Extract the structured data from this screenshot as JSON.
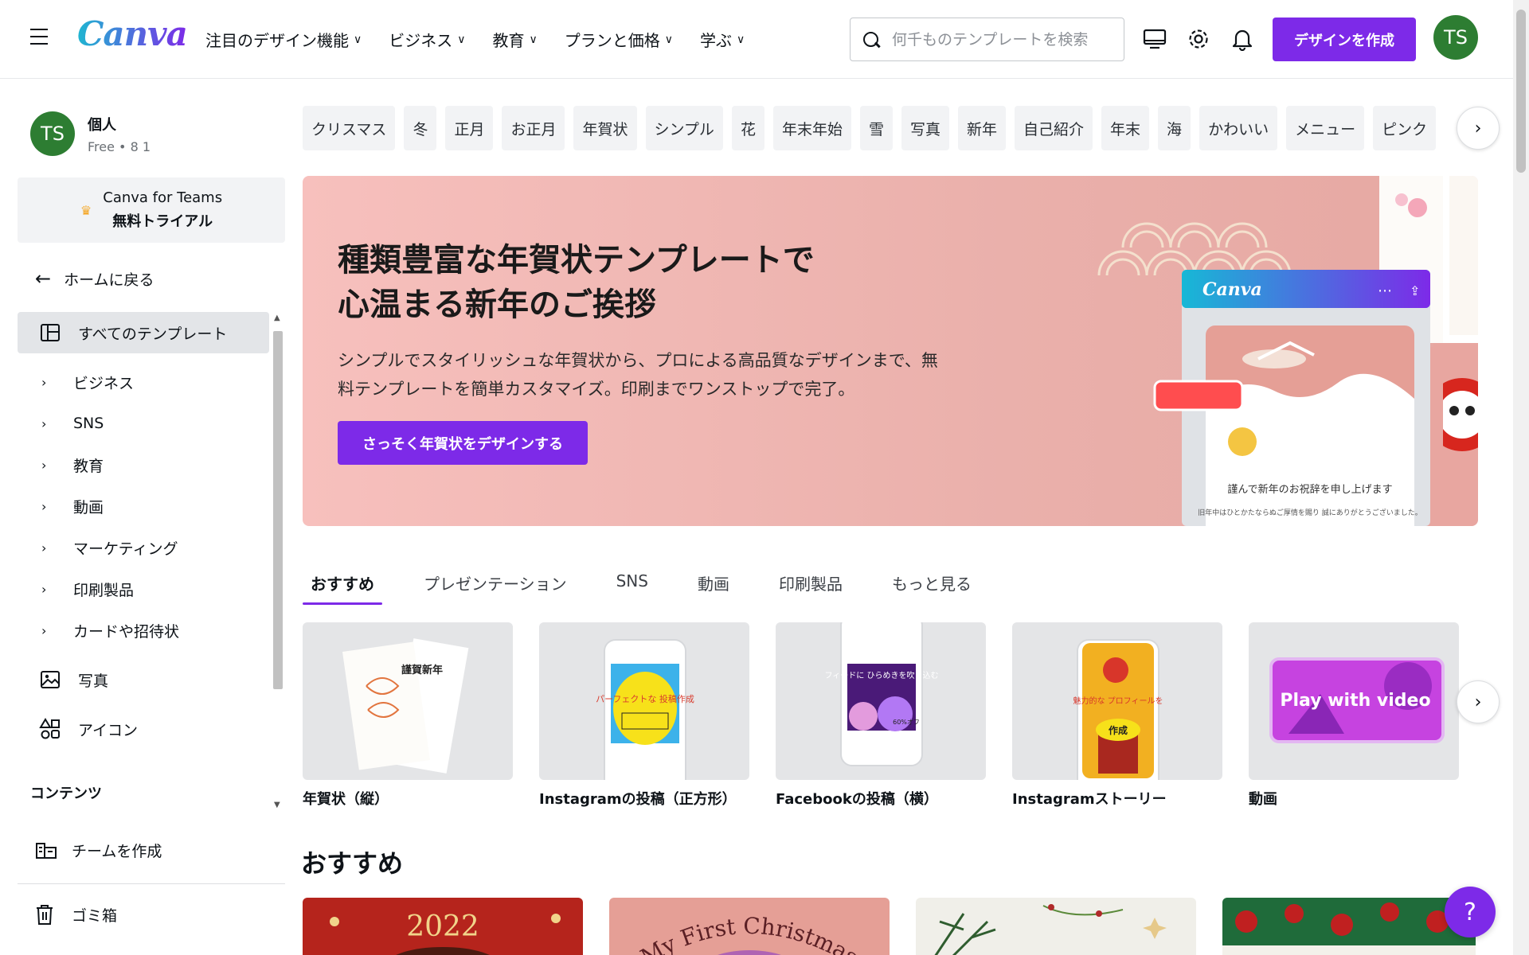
{
  "header": {
    "logo": "Canva",
    "nav": [
      {
        "label": "注目のデザイン機能"
      },
      {
        "label": "ビジネス"
      },
      {
        "label": "教育"
      },
      {
        "label": "プランと価格"
      },
      {
        "label": "学ぶ"
      }
    ],
    "search_placeholder": "何千ものテンプレートを検索",
    "create_button": "デザインを作成",
    "avatar_initials": "TS"
  },
  "sidebar": {
    "account_name": "個人",
    "account_plan": "Free • 8 1",
    "avatar_initials": "TS",
    "teams_line1": "Canva for Teams",
    "teams_line2": "無料トライアル",
    "back_home": "ホームに戻る",
    "items": [
      {
        "label": "すべてのテンプレート",
        "icon": "template-icon"
      },
      {
        "label": "ビジネス"
      },
      {
        "label": "SNS"
      },
      {
        "label": "教育"
      },
      {
        "label": "動画"
      },
      {
        "label": "マーケティング"
      },
      {
        "label": "印刷製品"
      },
      {
        "label": "カードや招待状"
      },
      {
        "label": "写真",
        "icon": "photo-icon"
      },
      {
        "label": "アイコン",
        "icon": "shapes-icon"
      }
    ],
    "content_label": "コンテンツ",
    "create_team": "チームを作成",
    "trash": "ゴミ箱"
  },
  "chips": [
    "クリスマス",
    "冬",
    "正月",
    "お正月",
    "年賀状",
    "シンプル",
    "花",
    "年末年始",
    "雪",
    "写真",
    "新年",
    "自己紹介",
    "年末",
    "海",
    "かわいい",
    "メニュー",
    "ピンク"
  ],
  "banner": {
    "title": "種類豊富な年賀状テンプレートで 心温まる新年のご挨拶",
    "description": "シンプルでスタイリッシュな年賀状から、プロによる高品質なデザインまで、無料テンプレートを簡単カスタマイズ。印刷までワンストップで完了。",
    "button": "さっそく年賀状をデザインする",
    "preview_logo": "Canva",
    "preview_text": "謹んで新年のお祝辞を申し上げます",
    "preview_small_text": "旧年中はひとかたならぬご厚情を賜り 誠にありがとうございました。"
  },
  "category_tabs": [
    {
      "label": "おすすめ",
      "active": true
    },
    {
      "label": "プレゼンテーション"
    },
    {
      "label": "SNS"
    },
    {
      "label": "動画"
    },
    {
      "label": "印刷製品"
    },
    {
      "label": "もっと見る"
    }
  ],
  "design_types": [
    {
      "label": "年賀状（縦）",
      "thumb_text": "謹賀新年"
    },
    {
      "label": "Instagramの投稿（正方形）",
      "thumb_text": "パーフェクトな 投稿作成"
    },
    {
      "label": "Facebookの投稿（横）",
      "thumb_text": "フィードに ひらめきを吹き込む",
      "thumb_badge": "60%オフ"
    },
    {
      "label": "Instagramストーリー",
      "thumb_text": "魅力的な プロフィールを",
      "thumb_badge": "作成"
    },
    {
      "label": "動画",
      "thumb_text": "Play with video"
    }
  ],
  "recommended_title": "おすすめ",
  "recommended_cards": [
    {
      "text": "2022"
    },
    {
      "text": "My First Christmas"
    }
  ],
  "help_label": "?"
}
